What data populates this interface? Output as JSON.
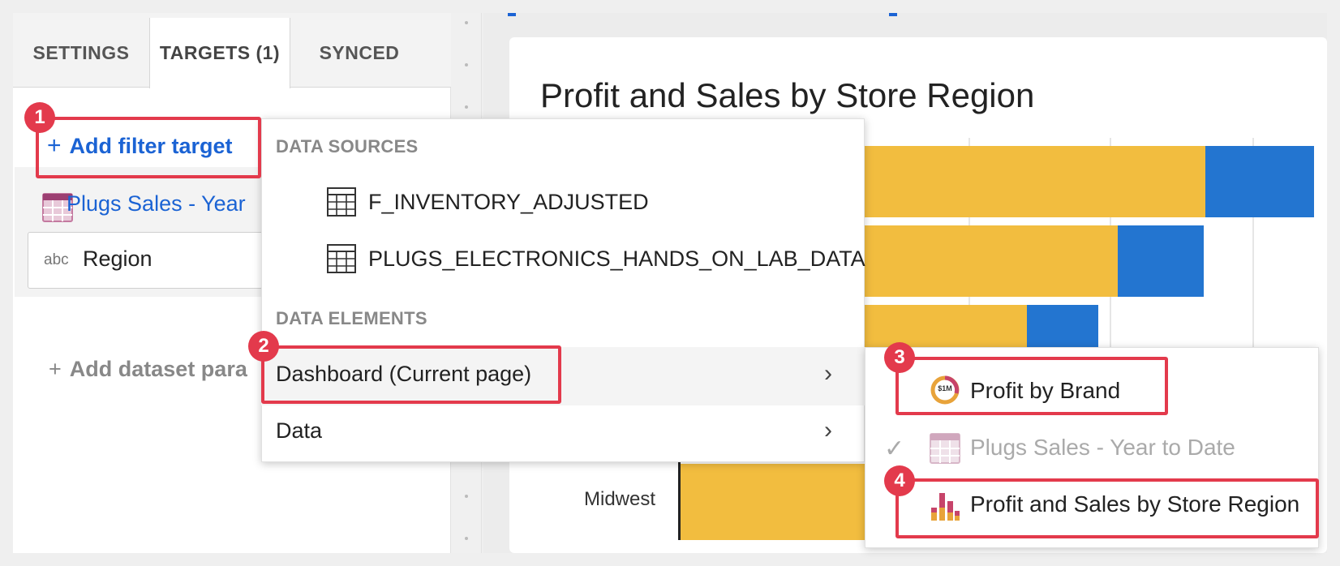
{
  "panel": {
    "tabs": [
      {
        "label": "SETTINGS"
      },
      {
        "label": "TARGETS (1)"
      },
      {
        "label": "SYNCED"
      }
    ],
    "add_filter_label": "Add filter target",
    "plus": "+",
    "target_card": {
      "title": "Plugs Sales - Year",
      "type_tag": "abc",
      "column": "Region"
    },
    "add_param_label": "Add dataset para"
  },
  "chart": {
    "title": "Profit and Sales by Store Region",
    "row_label": "Midwest",
    "colors": {
      "profit": "#f2bd3f",
      "sales": "#2375d0"
    }
  },
  "menu": {
    "data_sources_header": "DATA SOURCES",
    "sources": [
      "F_INVENTORY_ADJUSTED",
      "PLUGS_ELECTRONICS_HANDS_ON_LAB_DATA"
    ],
    "data_elements_header": "DATA ELEMENTS",
    "elements": [
      {
        "label": "Dashboard (Current page)"
      },
      {
        "label": "Data"
      }
    ],
    "chevron": "›"
  },
  "submenu": {
    "items": [
      {
        "label": "Profit by Brand",
        "icon": "donut-chart-icon",
        "icon_text": "$1M"
      },
      {
        "label": "Plugs Sales - Year to Date",
        "icon": "table-icon",
        "selected": true
      },
      {
        "label": "Profit and Sales by Store Region",
        "icon": "bar-chart-icon"
      }
    ],
    "check": "✓"
  },
  "annotations": {
    "badges": [
      "1",
      "2",
      "3",
      "4"
    ],
    "color": "#e33a4c"
  }
}
